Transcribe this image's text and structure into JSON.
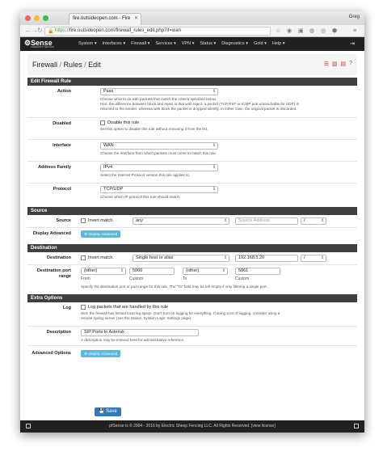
{
  "browser": {
    "tab_title": "fire.outsideopen.com - Fire",
    "user": "Greg",
    "url_scheme": "https://",
    "url_rest": "fire.outsideopen.com/firewall_rules_edit.php?if=wan"
  },
  "topnav": {
    "logo": "Sense",
    "logo_sub": "COMMUNITY EDITION",
    "items": [
      "System ▾",
      "Interfaces ▾",
      "Firewall ▾",
      "Services ▾",
      "VPN ▾",
      "Status ▾",
      "Diagnostics ▾",
      "Gold ▾",
      "Help ▾"
    ]
  },
  "breadcrumb": {
    "a": "Firewall",
    "b": "Rules",
    "c": "Edit",
    "sep": "/"
  },
  "edit": {
    "header": "Edit Firewall Rule",
    "action": {
      "label": "Action",
      "value": "Pass",
      "help": "Choose what to do with packets that match the criteria specified below.",
      "help2": "Hint: the difference between block and reject is that with reject, a packet (TCP RST or ICMP port unreachable for UDP) is",
      "help3": "returned to the sender, whereas with block the packet is dropped silently. In either case, the original packet is discarded."
    },
    "disabled": {
      "label": "Disabled",
      "check": "Disable this rule",
      "help": "Set this option to disable this rule without removing it from the list."
    },
    "interface": {
      "label": "Interface",
      "value": "WAN",
      "help": "Choose the interface from which packets must come to match this rule."
    },
    "family": {
      "label": "Address Family",
      "value": "IPv4",
      "help": "Select the Internet Protocol version this rule applies to."
    },
    "protocol": {
      "label": "Protocol",
      "value": "TCP/UDP",
      "help": "Choose which IP protocol this rule should match."
    }
  },
  "source": {
    "header": "Source",
    "label": "Source",
    "invert": "Invert match.",
    "type": "any",
    "address_placeholder": "Source Address",
    "slash": "/",
    "adv_label": "Display Advanced",
    "adv_button": "Display Advanced"
  },
  "destination": {
    "header": "Destination",
    "label": "Destination",
    "invert": "Invert match.",
    "type": "Single host or alias",
    "address": "192.168.5.20",
    "slash": "/",
    "port_label": "Destination port range",
    "from_sel": "(other)",
    "from_val": "5060",
    "to_sel": "(other)",
    "to_val": "5061",
    "from": "From",
    "custom": "Custom",
    "to": "To",
    "help": "Specify the destination port or port range for this rule. The \"To\" field may be left empty if only filtering a single port."
  },
  "extra": {
    "header": "Extra Options",
    "log_label": "Log",
    "log_check": "Log packets that are handled by this rule",
    "log_help": "Hint: the firewall has limited local log space. Don't turn on logging for everything. If doing a lot of logging, consider using a",
    "log_help2": "remote syslog server (see the Status: System Logs: Settings page).",
    "desc_label": "Description",
    "desc_value": "SIP Ports to Asterisk",
    "desc_help": "A description may be entered here for administrative reference.",
    "adv_label": "Advanced Options",
    "adv_button": "Display Advanced"
  },
  "save": "Save",
  "footer": "pfSense is © 2004 - 2016 by Electric Sheep Fencing LLC. All Rights Reserved. [view license]"
}
